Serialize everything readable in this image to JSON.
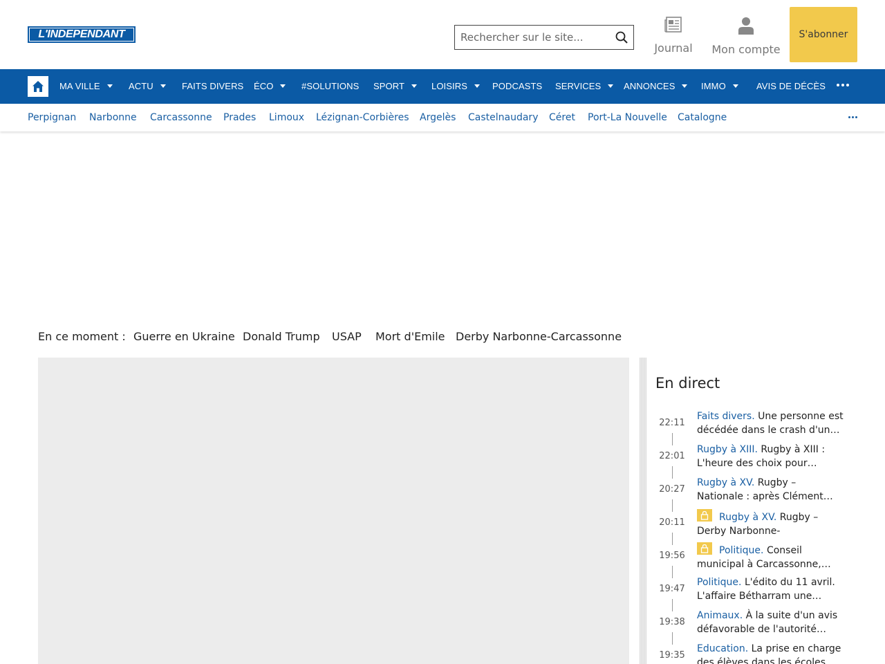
{
  "header": {
    "logo_text": "L'INDEPENDANT",
    "search_placeholder": "Rechercher sur le site...",
    "journal_label": "Journal",
    "account_label": "Mon compte",
    "subscribe_label": "S'abonner",
    "colors": {
      "brand_blue": "#0b5aa5",
      "subscribe_yellow": "#f2c94c"
    }
  },
  "nav": {
    "items": [
      {
        "label": "MA VILLE",
        "dropdown": true
      },
      {
        "label": "ACTU",
        "dropdown": true
      },
      {
        "label": "FAITS DIVERS",
        "dropdown": false
      },
      {
        "label": "ÉCO",
        "dropdown": true
      },
      {
        "label": "#SOLUTIONS",
        "dropdown": false
      },
      {
        "label": "SPORT",
        "dropdown": true
      },
      {
        "label": "LOISIRS",
        "dropdown": true
      },
      {
        "label": "PODCASTS",
        "dropdown": false
      },
      {
        "label": "SERVICES",
        "dropdown": true
      },
      {
        "label": "ANNONCES",
        "dropdown": true
      },
      {
        "label": "IMMO",
        "dropdown": true
      },
      {
        "label": "AVIS DE DÉCÈS",
        "dropdown": false
      }
    ]
  },
  "cities": [
    "Perpignan",
    "Narbonne",
    "Carcassonne",
    "Prades",
    "Limoux",
    "Lézignan-Corbières",
    "Argelès",
    "Castelnaudary",
    "Céret",
    "Port-La Nouvelle",
    "Catalogne"
  ],
  "trending": {
    "label": "En ce moment :",
    "topics": [
      "Guerre en Ukraine",
      "Donald Trump",
      "USAP",
      "Mort d'Emile",
      "Derby Narbonne-Carcassonne"
    ]
  },
  "live": {
    "title": "En direct",
    "items": [
      {
        "time": "22:11",
        "category": "Faits divers.",
        "text": "Une personne est décédée dans le crash d'un…",
        "locked": false
      },
      {
        "time": "22:01",
        "category": "Rugby à XIII.",
        "text": "Rugby à XIII : L'heure des choix pour…",
        "locked": false
      },
      {
        "time": "20:27",
        "category": "Rugby à XV.",
        "text": "Rugby – Nationale : après Clément…",
        "locked": false
      },
      {
        "time": "20:11",
        "category": "Rugby à XV.",
        "text": "Rugby – Derby Narbonne-Carcassonn…",
        "locked": true
      },
      {
        "time": "19:56",
        "category": "Politique.",
        "text": "Conseil municipal à Carcassonne,…",
        "locked": true
      },
      {
        "time": "19:47",
        "category": "Politique.",
        "text": "L'édito du 11 avril. L'affaire Bétharram une…",
        "locked": false
      },
      {
        "time": "19:38",
        "category": "Animaux.",
        "text": "À la suite d'un avis défavorable de l'autorité…",
        "locked": false
      },
      {
        "time": "19:35",
        "category": "Education.",
        "text": "La prise en charge des élèves dans les écoles…",
        "locked": false
      }
    ]
  }
}
